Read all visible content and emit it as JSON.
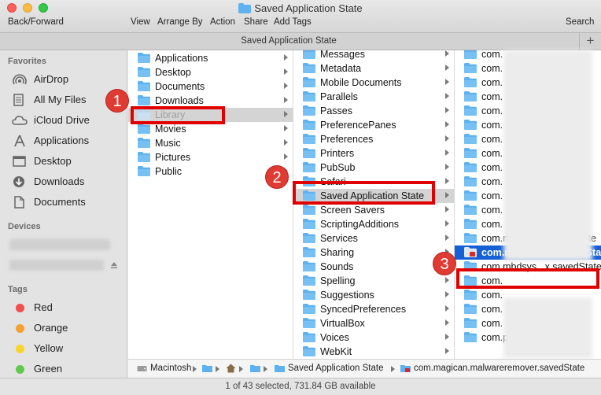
{
  "window": {
    "title": "Saved Application State"
  },
  "toolbar": {
    "back_forward": "Back/Forward",
    "view": "View",
    "arrange_by": "Arrange By",
    "action": "Action",
    "share": "Share",
    "add_tags": "Add Tags",
    "search": "Search"
  },
  "tab": {
    "label": "Saved Application State",
    "new_tab": "+"
  },
  "sidebar": {
    "favorites_header": "Favorites",
    "favorites": [
      {
        "label": "AirDrop",
        "icon": "airdrop-icon"
      },
      {
        "label": "All My Files",
        "icon": "all-files-icon"
      },
      {
        "label": "iCloud Drive",
        "icon": "cloud-icon"
      },
      {
        "label": "Applications",
        "icon": "applications-icon"
      },
      {
        "label": "Desktop",
        "icon": "desktop-icon"
      },
      {
        "label": "Downloads",
        "icon": "download-icon"
      },
      {
        "label": "Documents",
        "icon": "document-icon"
      }
    ],
    "devices_header": "Devices",
    "tags_header": "Tags",
    "tags": [
      {
        "label": "Red",
        "color": "#f24e4e"
      },
      {
        "label": "Orange",
        "color": "#f6a031"
      },
      {
        "label": "Yellow",
        "color": "#f8d52d"
      },
      {
        "label": "Green",
        "color": "#5fc94e"
      }
    ]
  },
  "columns": {
    "home": [
      "Applications",
      "Desktop",
      "Documents",
      "Downloads",
      "Library",
      "Movies",
      "Music",
      "Pictures",
      "Public"
    ],
    "library": [
      "Messages",
      "Metadata",
      "Mobile Documents",
      "Parallels",
      "Passes",
      "PreferencePanes",
      "Preferences",
      "Printers",
      "PubSub",
      "Safari",
      "Saved Application State",
      "Screen Savers",
      "ScriptingAdditions",
      "Services",
      "Sharing",
      "Sounds",
      "Spelling",
      "Suggestions",
      "SyncedPreferences",
      "VirtualBox",
      "Voices",
      "WebKit"
    ],
    "saved_state": [
      "com.",
      "com.",
      "com.",
      "com.",
      "com.",
      "com.",
      "com.",
      "com.",
      "com.",
      "com.",
      "com.",
      "com.",
      "com.",
      "com.macpaw...savedState",
      "com.magica...er.savedState",
      "com.mbdsys...x.savedState",
      "com.",
      "com.",
      "com.",
      "com.",
      "com.p"
    ]
  },
  "annotations": {
    "step1": "1",
    "step2": "2",
    "step3": "3"
  },
  "pathbar": {
    "items": [
      "Macintosh",
      "Saved Application State",
      "com.magican.malwareremover.savedState"
    ]
  },
  "status": {
    "text": "1 of 43 selected, 731.84 GB available"
  },
  "colors": {
    "selection": "#1560d6",
    "folder": "#5fb2ef",
    "annotation": "#e00000"
  }
}
